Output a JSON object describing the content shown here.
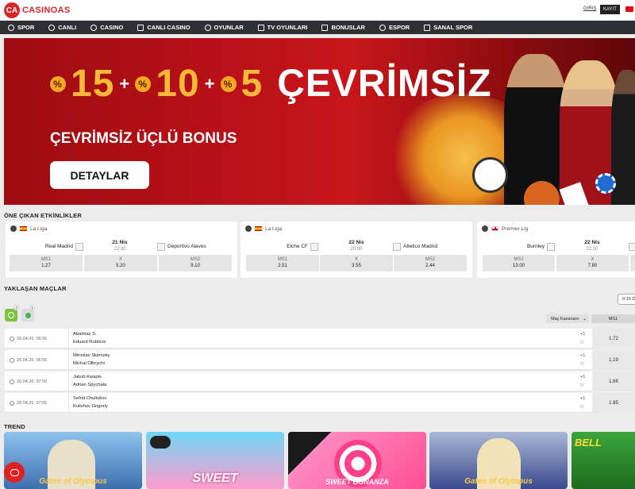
{
  "header": {
    "logo_mark": "CA",
    "logo_text": "CASINOAS",
    "login_label": "GIRIŞ",
    "register_label": "KAYIT"
  },
  "nav": {
    "items": [
      {
        "label": "SPOR",
        "icon": "soccer-ball-icon"
      },
      {
        "label": "CANLI",
        "icon": "live-icon"
      },
      {
        "label": "CASINO",
        "icon": "dice-icon"
      },
      {
        "label": "CANLI CASINO",
        "icon": "cards-icon"
      },
      {
        "label": "OYUNLAR",
        "icon": "gamepad-icon"
      },
      {
        "label": "TV OYUNLARI",
        "icon": "tv-icon"
      },
      {
        "label": "BONUSLAR",
        "icon": "gift-icon"
      },
      {
        "label": "ESPOR",
        "icon": "esport-icon"
      },
      {
        "label": "SANAL SPOR",
        "icon": "virtual-sport-icon"
      }
    ]
  },
  "banner": {
    "n1": "15",
    "n2": "10",
    "n3": "5",
    "pct": "%",
    "plus": "+",
    "headline_word": "ÇEVRİMSİZ",
    "subtitle": "ÇEVRİMSİZ ÜÇLÜ BONUS",
    "button_label": "DETAYLAR"
  },
  "featured": {
    "title": "ÖNE ÇIKAN ETKİNLİKLER",
    "prev_arrow": "‹",
    "events": [
      {
        "league": "La Liga",
        "home": "Real Madrid",
        "away": "Deportivo Alaves",
        "date": "21 Nis",
        "time": "22:30",
        "odds": [
          {
            "label": "MS1",
            "value": "1.27"
          },
          {
            "label": "X",
            "value": "5.20"
          },
          {
            "label": "MS2",
            "value": "9.10"
          }
        ]
      },
      {
        "league": "La Liga",
        "home": "Elche CF",
        "away": "Atletico Madrid",
        "date": "22 Nis",
        "time": "20:00",
        "odds": [
          {
            "label": "MS1",
            "value": "2.51"
          },
          {
            "label": "X",
            "value": "3.55"
          },
          {
            "label": "MS2",
            "value": "2.44"
          }
        ]
      },
      {
        "league": "Premier Lig",
        "home": "Burnley",
        "away": "",
        "date": "22 Nis",
        "time": "22:00",
        "odds": [
          {
            "label": "MS1",
            "value": "13.00"
          },
          {
            "label": "X",
            "value": "7.80"
          },
          {
            "label": "MS2",
            "value": ""
          }
        ]
      }
    ]
  },
  "upcoming": {
    "title": "YAKLAŞAN MAÇLAR",
    "sport_badges": [
      "4",
      "1"
    ],
    "date_filter": "0-15 D",
    "market_select": "Maç Kazananı",
    "market_column": "MS1",
    "matches": [
      {
        "datetime": "20.04.26, 06:55",
        "p1": "Abalmaz S.",
        "p2": "Eduard Rubtsov",
        "more": "+1",
        "odd": "1.72"
      },
      {
        "datetime": "20.04.26, 06:55",
        "p1": "Miroslav Sklensky",
        "p2": "Michal Olbrycht",
        "more": "+1",
        "odd": "1.19"
      },
      {
        "datetime": "20.04.26, 07:00",
        "p1": "Jakub Kwapis",
        "p2": "Adrian Spychala",
        "more": "+1",
        "odd": "1.66"
      },
      {
        "datetime": "20.04.26, 07:05",
        "p1": "Sefrid Chuliukov",
        "p2": "Kulishov Grigoriy",
        "more": "+1",
        "odd": "1.85"
      }
    ]
  },
  "trend": {
    "title": "TREND",
    "games": [
      {
        "title": "Gates of Olympus",
        "bg": "#5c9bd6"
      },
      {
        "title": "SWEET",
        "bg": "#35b8e0"
      },
      {
        "title": "SWEET BONANZA",
        "bg": "#ff6fb0"
      },
      {
        "title": "Gates of Olympus",
        "bg": "#3a4a8c"
      },
      {
        "title": "BELL",
        "bg": "#2a8a2a"
      }
    ]
  },
  "colors": {
    "brand": "#d8262a",
    "nav_bg": "#2f3033",
    "banner": "#b81117",
    "gold": "#f7b938"
  }
}
